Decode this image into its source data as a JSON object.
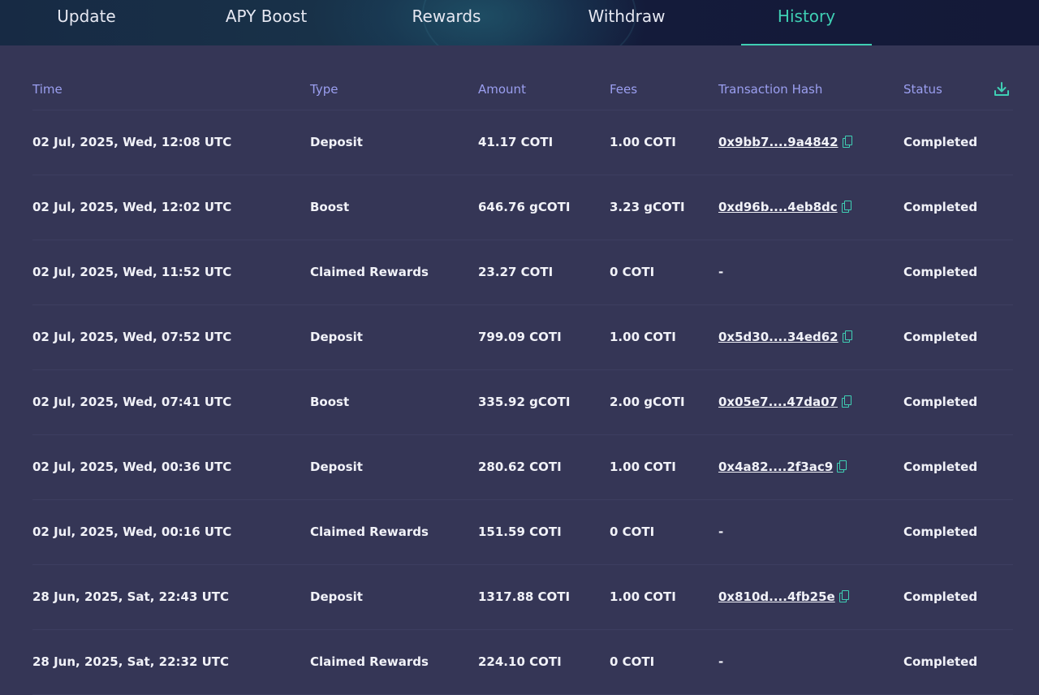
{
  "tabs": [
    {
      "label": "Update",
      "active": false
    },
    {
      "label": "APY Boost",
      "active": false
    },
    {
      "label": "Rewards",
      "active": false
    },
    {
      "label": "Withdraw",
      "active": false
    },
    {
      "label": "History",
      "active": true
    }
  ],
  "table": {
    "columns": {
      "time": "Time",
      "type": "Type",
      "amount": "Amount",
      "fees": "Fees",
      "hash": "Transaction Hash",
      "status": "Status"
    },
    "download_icon": "download-icon",
    "copy_icon": "copy-icon",
    "rows": [
      {
        "time": "02 Jul, 2025, Wed, 12:08 UTC",
        "type": "Deposit",
        "amount": "41.17 COTI",
        "fees": "1.00 COTI",
        "hash": "0x9bb7....9a4842",
        "status": "Completed"
      },
      {
        "time": "02 Jul, 2025, Wed, 12:02 UTC",
        "type": "Boost",
        "amount": "646.76 gCOTI",
        "fees": "3.23 gCOTI",
        "hash": "0xd96b....4eb8dc",
        "status": "Completed"
      },
      {
        "time": "02 Jul, 2025, Wed, 11:52 UTC",
        "type": "Claimed Rewards",
        "amount": "23.27 COTI",
        "fees": "0 COTI",
        "hash": "-",
        "status": "Completed"
      },
      {
        "time": "02 Jul, 2025, Wed, 07:52 UTC",
        "type": "Deposit",
        "amount": "799.09 COTI",
        "fees": "1.00 COTI",
        "hash": "0x5d30....34ed62",
        "status": "Completed"
      },
      {
        "time": "02 Jul, 2025, Wed, 07:41 UTC",
        "type": "Boost",
        "amount": "335.92 gCOTI",
        "fees": "2.00 gCOTI",
        "hash": "0x05e7....47da07",
        "status": "Completed"
      },
      {
        "time": "02 Jul, 2025, Wed, 00:36 UTC",
        "type": "Deposit",
        "amount": "280.62 COTI",
        "fees": "1.00 COTI",
        "hash": "0x4a82....2f3ac9",
        "status": "Completed"
      },
      {
        "time": "02 Jul, 2025, Wed, 00:16 UTC",
        "type": "Claimed Rewards",
        "amount": "151.59 COTI",
        "fees": "0 COTI",
        "hash": "-",
        "status": "Completed"
      },
      {
        "time": "28 Jun, 2025, Sat, 22:43 UTC",
        "type": "Deposit",
        "amount": "1317.88 COTI",
        "fees": "1.00 COTI",
        "hash": "0x810d....4fb25e",
        "status": "Completed"
      },
      {
        "time": "28 Jun, 2025, Sat, 22:32 UTC",
        "type": "Claimed Rewards",
        "amount": "224.10 COTI",
        "fees": "0 COTI",
        "hash": "-",
        "status": "Completed"
      }
    ]
  },
  "colors": {
    "background": "#353656",
    "accent": "#3fcfb4",
    "header_text": "#9b9ff0",
    "row_text": "#f1f2f8"
  }
}
